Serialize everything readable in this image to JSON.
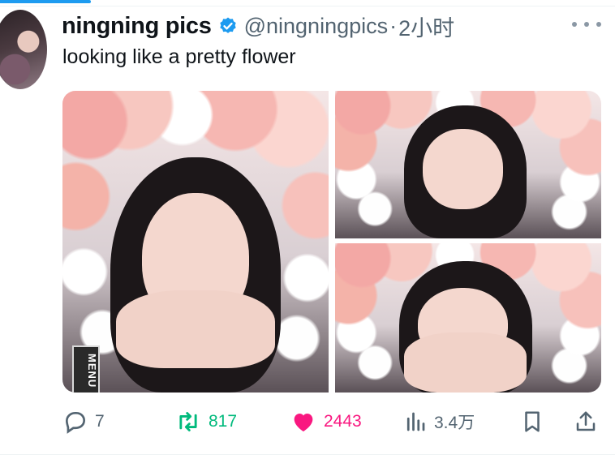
{
  "post": {
    "author": {
      "display_name": "ningning pics",
      "verified": true,
      "handle": "@ningningpics",
      "separator": "·",
      "time": "2小时"
    },
    "text": "looking like a pretty flower",
    "media": {
      "badge_text": "MENU"
    },
    "actions": {
      "replies": "7",
      "reposts": "817",
      "likes": "2443",
      "views": "3.4万"
    }
  },
  "icons": {
    "verified": "verified-badge-icon",
    "more": "more-icon",
    "reply": "reply-icon",
    "repost": "repost-icon",
    "like": "heart-icon",
    "views": "views-icon",
    "bookmark": "bookmark-icon",
    "share": "share-icon"
  },
  "colors": {
    "accent": "#1d9bf0",
    "repost": "#00ba7c",
    "like": "#f91880",
    "secondary_text": "#536471"
  }
}
